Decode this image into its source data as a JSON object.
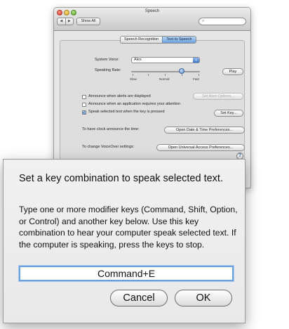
{
  "window": {
    "title": "Speech",
    "nav_back": "◀",
    "nav_forward": "▶",
    "show_all": "Show All",
    "search_glyph": "⌕",
    "tabs": [
      {
        "label": "Speech Recognition",
        "selected": false
      },
      {
        "label": "Text to Speech",
        "selected": true
      }
    ],
    "system_voice_label": "System Voice:",
    "system_voice_value": "Alex",
    "speaking_rate_label": "Speaking Rate:",
    "rate_slow": "Slow",
    "rate_normal": "Normal",
    "rate_fast": "Fast",
    "rate_level_percent": 73,
    "play_button": "Play",
    "options": [
      {
        "label": "Announce when alerts are displayed",
        "checked": false
      },
      {
        "label": "Announce when an application requires your attention",
        "checked": false
      },
      {
        "label": "Speak selected text when the key is pressed",
        "checked": true
      }
    ],
    "set_alert_options": "Set Alert Options...",
    "set_key": "Set Key...",
    "clock_label": "To have clock announce the time:",
    "date_time_button": "Open Date & Time Preferences...",
    "voiceover_label": "To change VoiceOver settings:",
    "universal_access_button": "Open Universal Access Preferences...",
    "help_glyph": "?"
  },
  "dialog": {
    "title": "Set a key combination to speak selected text.",
    "body": "Type one or more modifier keys (Command, Shift, Option, or Control) and another key below. Use this key combination to hear your computer speak selected text. If the computer is speaking, press the keys to stop.",
    "key_value": "Command+E",
    "cancel_label": "Cancel",
    "ok_label": "OK"
  },
  "colors": {
    "accent": "#6aa0dc",
    "window_bg": "#e6e6e6",
    "dialog_bg": "#efefef"
  }
}
